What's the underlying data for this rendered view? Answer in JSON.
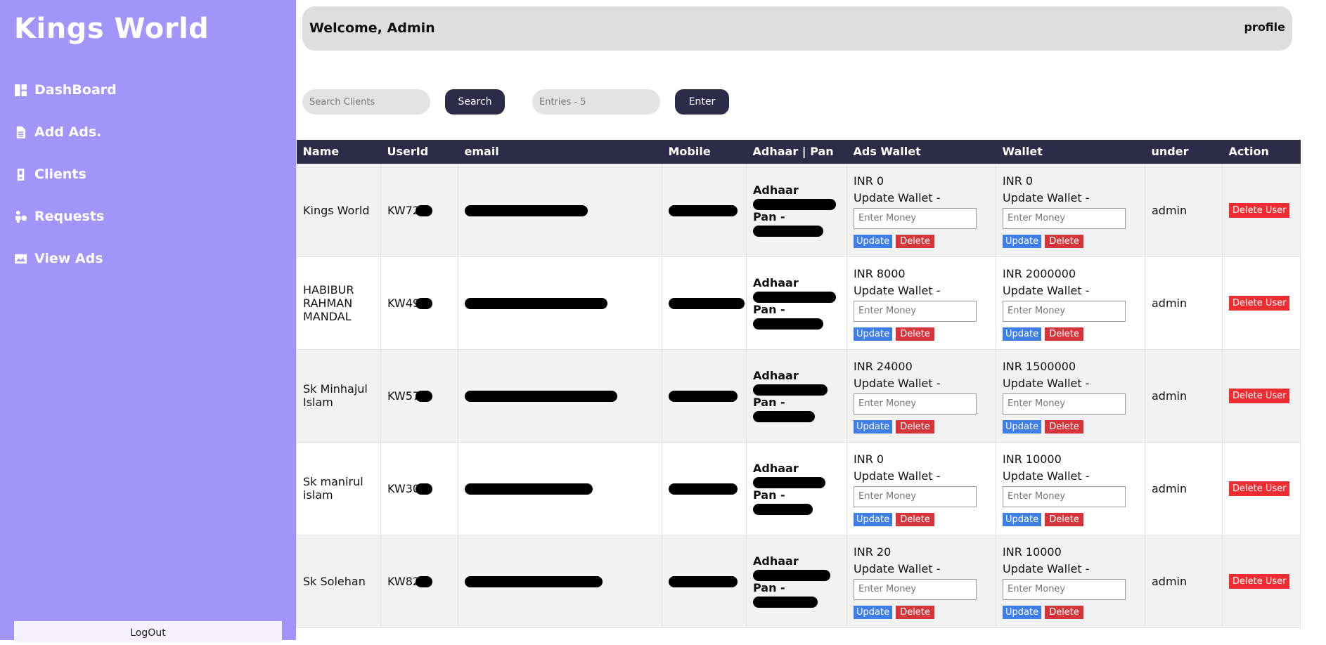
{
  "sidebar": {
    "brand": "Kings World",
    "items": [
      {
        "label": "DashBoard",
        "icon": "dashboard-icon"
      },
      {
        "label": "Add Ads.",
        "icon": "document-icon"
      },
      {
        "label": "Clients",
        "icon": "phone-icon"
      },
      {
        "label": "Requests",
        "icon": "person-request-icon"
      },
      {
        "label": "View Ads",
        "icon": "images-icon"
      }
    ],
    "logout": "LogOut"
  },
  "header": {
    "welcome": "Welcome, Admin",
    "profile": "profile"
  },
  "controls": {
    "search_placeholder": "Search Clients",
    "search_button": "Search",
    "entries_placeholder": "Entries - 5",
    "enter_button": "Enter"
  },
  "table": {
    "columns": [
      "Name",
      "UserId",
      "email",
      "Mobile",
      "Adhaar | Pan",
      "Ads Wallet",
      "Wallet",
      "under",
      "Action"
    ],
    "labels": {
      "adhaar": "Adhaar",
      "pan": "Pan -",
      "update_wallet": "Update Wallet -",
      "money_placeholder": "Enter Money",
      "update": "Update",
      "delete": "Delete",
      "delete_user": "Delete User"
    },
    "rows": [
      {
        "name": "Kings World",
        "userid": "KW72",
        "ads_wallet": "INR 0",
        "wallet": "INR 0",
        "under": "admin"
      },
      {
        "name": "HABIBUR RAHMAN MANDAL",
        "userid": "KW49",
        "ads_wallet": "INR 8000",
        "wallet": "INR 2000000",
        "under": "admin"
      },
      {
        "name": "Sk Minhajul Islam",
        "userid": "KW57",
        "ads_wallet": "INR 24000",
        "wallet": "INR 1500000",
        "under": "admin"
      },
      {
        "name": "Sk manirul islam",
        "userid": "KW30",
        "ads_wallet": "INR 0",
        "wallet": "INR 10000",
        "under": "admin"
      },
      {
        "name": "Sk Solehan",
        "userid": "KW82",
        "ads_wallet": "INR 20",
        "wallet": "INR 10000",
        "under": "admin"
      }
    ]
  },
  "colors": {
    "sidebar_bg": "#a294f9",
    "header_bg": "#2d2b47",
    "update_btn": "#3f7fe5",
    "delete_btn": "#d6353c"
  }
}
